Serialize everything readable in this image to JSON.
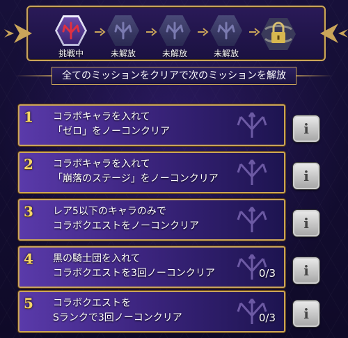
{
  "stages": [
    {
      "label": "挑戦中",
      "state": "active"
    },
    {
      "label": "未解放",
      "state": "locked"
    },
    {
      "label": "未解放",
      "state": "locked"
    },
    {
      "label": "未解放",
      "state": "locked"
    },
    {
      "label": "",
      "state": "padlock"
    }
  ],
  "banner": {
    "text": "全てのミッションをクリアで次のミッションを解放"
  },
  "missions": [
    {
      "number": "1",
      "line1": "コラボキャラを入れて",
      "line2": "「ゼロ」をノーコンクリア",
      "progress": ""
    },
    {
      "number": "2",
      "line1": "コラボキャラを入れて",
      "line2": "「崩落のステージ」をノーコンクリア",
      "progress": ""
    },
    {
      "number": "3",
      "line1": "レア5以下のキャラのみで",
      "line2": "コラボクエストをノーコンクリア",
      "progress": ""
    },
    {
      "number": "4",
      "line1": "黒の騎士団を入れて",
      "line2": "コラボクエストを3回ノーコンクリア",
      "progress": "0/3"
    },
    {
      "number": "5",
      "line1": "コラボクエストを",
      "line2": "Sランクで3回ノーコンクリア",
      "progress": "0/3"
    }
  ],
  "info_button": {
    "glyph": "i"
  },
  "colors": {
    "gold": "#c9a45a",
    "active_emblem": "#e03040",
    "locked_emblem": "#7a7ab0"
  }
}
